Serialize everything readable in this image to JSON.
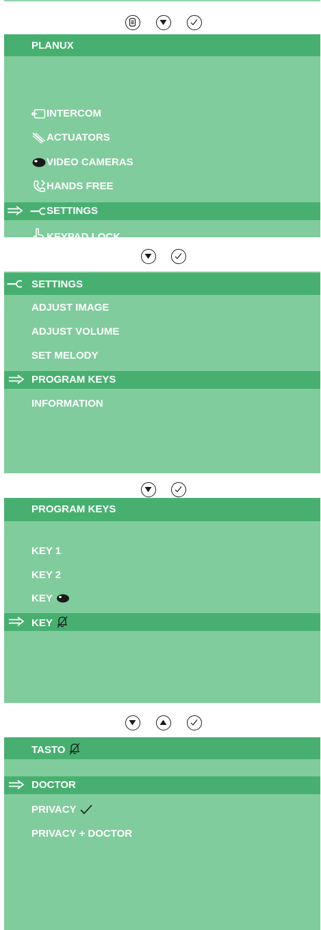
{
  "screen1": {
    "title": "PLANUX",
    "items": [
      {
        "label": "INTERCOM",
        "icon": "intercom-icon"
      },
      {
        "label": "ACTUATORS",
        "icon": "actuator-icon"
      },
      {
        "label": "VIDEO CAMERAS",
        "icon": "eye-icon"
      },
      {
        "label": "HANDS FREE",
        "icon": "phone-icon"
      },
      {
        "label": "SETTINGS",
        "icon": "wrench-icon",
        "selected": true
      },
      {
        "label": "KEYPAD LOCK",
        "icon": "hand-pointer-icon"
      }
    ]
  },
  "screen2": {
    "title": "SETTINGS",
    "items": [
      {
        "label": "ADJUST IMAGE"
      },
      {
        "label": "ADJUST VOLUME"
      },
      {
        "label": "SET MELODY"
      },
      {
        "label": "PROGRAM KEYS",
        "selected": true
      },
      {
        "label": "INFORMATION"
      }
    ]
  },
  "screen3": {
    "title": "PROGRAM KEYS",
    "items": [
      {
        "label": "KEY 1"
      },
      {
        "label": "KEY 2"
      },
      {
        "label": "KEY",
        "icon": "eye-icon"
      },
      {
        "label": "KEY",
        "icon": "bell-muted-icon",
        "selected": true
      }
    ]
  },
  "screen4": {
    "title": "TASTO",
    "title_icon": "bell-muted-icon",
    "items": [
      {
        "label": "DOCTOR",
        "selected": true
      },
      {
        "label": "PRIVACY",
        "icon": "checkmark-icon"
      },
      {
        "label": "PRIVACY + DOCTOR"
      }
    ]
  },
  "nav_buttons": [
    "menu-button",
    "down-button",
    "up-button",
    "confirm-button"
  ],
  "colors": {
    "screen_bg": "#80cc9c",
    "highlight": "#47b070",
    "text": "#ffffff"
  }
}
